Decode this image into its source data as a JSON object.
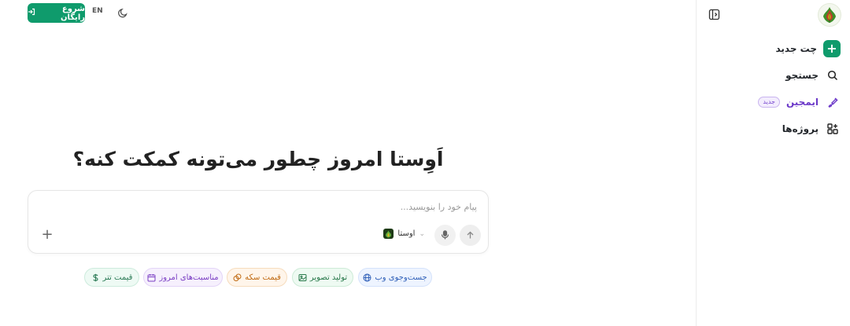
{
  "sidebar": {
    "logo": "avesta-logo-icon",
    "collapse_icon": "sidebar-collapse-icon",
    "items": [
      {
        "label": "چت جدید",
        "icon": "plus-icon"
      },
      {
        "label": "جستجو",
        "icon": "search-icon"
      },
      {
        "label": "ایمجین",
        "icon": "brush-icon",
        "badge": "جدید"
      },
      {
        "label": "پروژه‌ها",
        "icon": "grid-plus-icon"
      }
    ]
  },
  "topbar": {
    "start_label": "شروع رایگان",
    "lang_label": "EN",
    "theme_icon": "moon-icon"
  },
  "main": {
    "headline": "اَوِستا امروز چطور می‌تونه کمکت کنه؟",
    "composer": {
      "placeholder": "پیام خود را بنویسید...",
      "model_label": "اوستا",
      "send_icon": "arrow-up-icon",
      "mic_icon": "microphone-icon",
      "attach_icon": "plus-icon"
    },
    "chips": [
      {
        "label": "جست‌وجوی وب",
        "icon": "globe-icon"
      },
      {
        "label": "تولید تصویر",
        "icon": "image-icon"
      },
      {
        "label": "قیمت سکه",
        "icon": "coins-icon"
      },
      {
        "label": "مناسبت‌های امروز",
        "icon": "calendar-icon"
      },
      {
        "label": "قیمت تتر",
        "icon": "dollar-icon"
      }
    ]
  },
  "colors": {
    "brand": "#0f9b6c",
    "imagine": "#6b38c8"
  }
}
